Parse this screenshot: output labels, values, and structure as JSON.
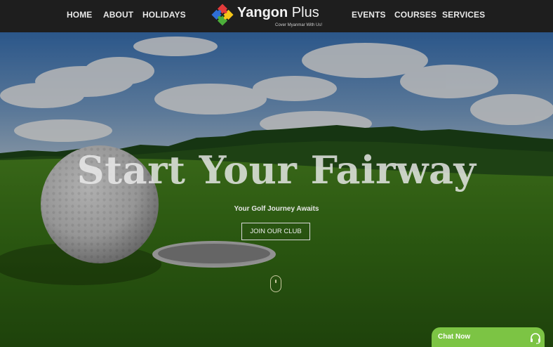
{
  "nav": {
    "left_links": [
      "HOME",
      "ABOUT",
      "HOLIDAYS"
    ],
    "right_links": [
      "EVENTS",
      "COURSES",
      "SERVICES"
    ],
    "logo": {
      "name_bold": "Yangon",
      "name_light": " Plus",
      "tagline": "Cover Myanmar With Us!"
    }
  },
  "hero": {
    "headline": "Start Your Fairway",
    "subheading": "Your Golf Journey Awaits",
    "cta_label": "JOIN OUR CLUB",
    "scroll_icon": "mouse-scroll-icon"
  },
  "chat": {
    "label": "Chat Now",
    "icon": "headset-icon"
  },
  "colors": {
    "nav_bg": "#1e1e1e",
    "chat_green": "#7cc444",
    "grass": "#3f7a1c",
    "sky": "#5b8fc7"
  }
}
